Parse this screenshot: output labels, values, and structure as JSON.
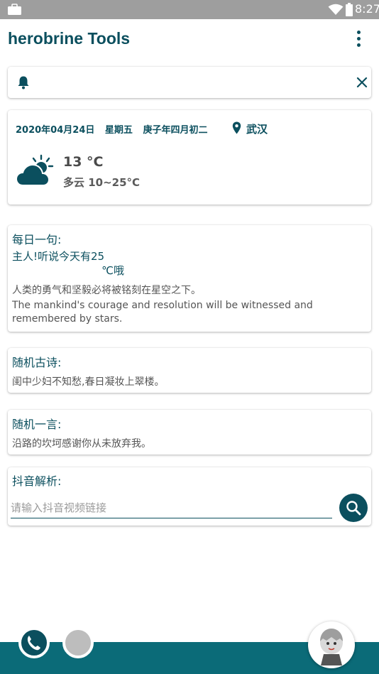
{
  "status_bar": {
    "time": "8:27",
    "icons": [
      "briefcase-icon",
      "wifi-icon",
      "battery-icon"
    ]
  },
  "app_bar": {
    "title": "herobrine Tools",
    "menu_icon": "more-vert-icon"
  },
  "notice": {
    "icon": "bell-icon",
    "close_icon": "close-icon"
  },
  "date_weather": {
    "date": "2020年04月24日",
    "weekday": "星期五",
    "lunar_date": "庚子年四月初二",
    "location_icon": "map-pin-icon",
    "city": "武汉",
    "weather_icon": "cloudy-sun-icon",
    "temperature": "13 °C",
    "condition": "多云 10~25°C"
  },
  "daily_quote": {
    "title": "每日一句:",
    "greeting_line1": "主人!听说今天有25",
    "greeting_line2": "℃哦",
    "quote_cn": "人类的勇气和坚毅必将被铭刻在星空之下。",
    "quote_en": "The mankind's courage and resolution will be witnessed and remembered by stars."
  },
  "random_poem": {
    "title": "随机古诗:",
    "text": "闺中少妇不知愁,春日凝妆上翠楼。"
  },
  "random_saying": {
    "title": "随机一言:",
    "text": "沿路的坎坷感谢你从未放弃我。"
  },
  "douyin_parse": {
    "title": "抖音解析:",
    "input_value": "",
    "placeholder": "请输入抖音视频链接",
    "search_icon": "search-icon"
  },
  "colors": {
    "primary": "#0b4f5e",
    "bottom_bar": "#0b6b78",
    "status_bar": "#9e9e9e"
  }
}
